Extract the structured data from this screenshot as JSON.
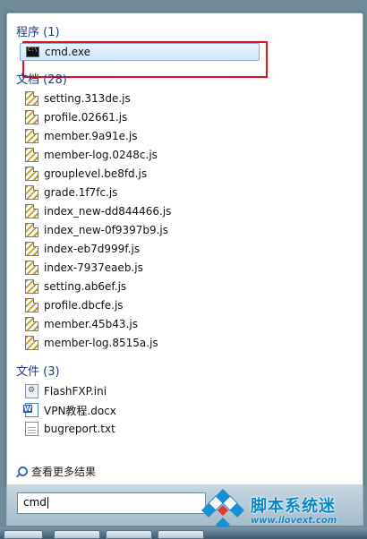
{
  "groups": {
    "programs": {
      "header": "程序 (1)",
      "items": [
        {
          "label": "cmd.exe",
          "icon": "cmd-icon"
        }
      ]
    },
    "documents": {
      "header": "文档 (28)",
      "items": [
        "setting.313de.js",
        "profile.02661.js",
        "member.9a91e.js",
        "member-log.0248c.js",
        "grouplevel.be8fd.js",
        "grade.1f7fc.js",
        "index_new-dd844466.js",
        "index_new-0f9397b9.js",
        "index-eb7d999f.js",
        "index-7937eaeb.js",
        "setting.ab6ef.js",
        "profile.dbcfe.js",
        "member.45b43.js",
        "member-log.8515a.js"
      ]
    },
    "files": {
      "header": "文件 (3)",
      "items": [
        {
          "label": "FlashFXP.ini",
          "icon": "ini-settings-icon"
        },
        {
          "label": "VPN教程.docx",
          "icon": "word-document-icon"
        },
        {
          "label": "bugreport.txt",
          "icon": "text-file-icon"
        }
      ]
    }
  },
  "see_more": {
    "label": "查看更多结果",
    "icon": "search-icon"
  },
  "search": {
    "value": "cmd"
  },
  "watermark": {
    "title": "脚本系统迷",
    "url": "www.ilovext.com"
  },
  "colors": {
    "header": "#1e3b87",
    "highlight_border": "#e0131b",
    "selection": "#cfe6fb",
    "watermark": "#0a86c9"
  }
}
